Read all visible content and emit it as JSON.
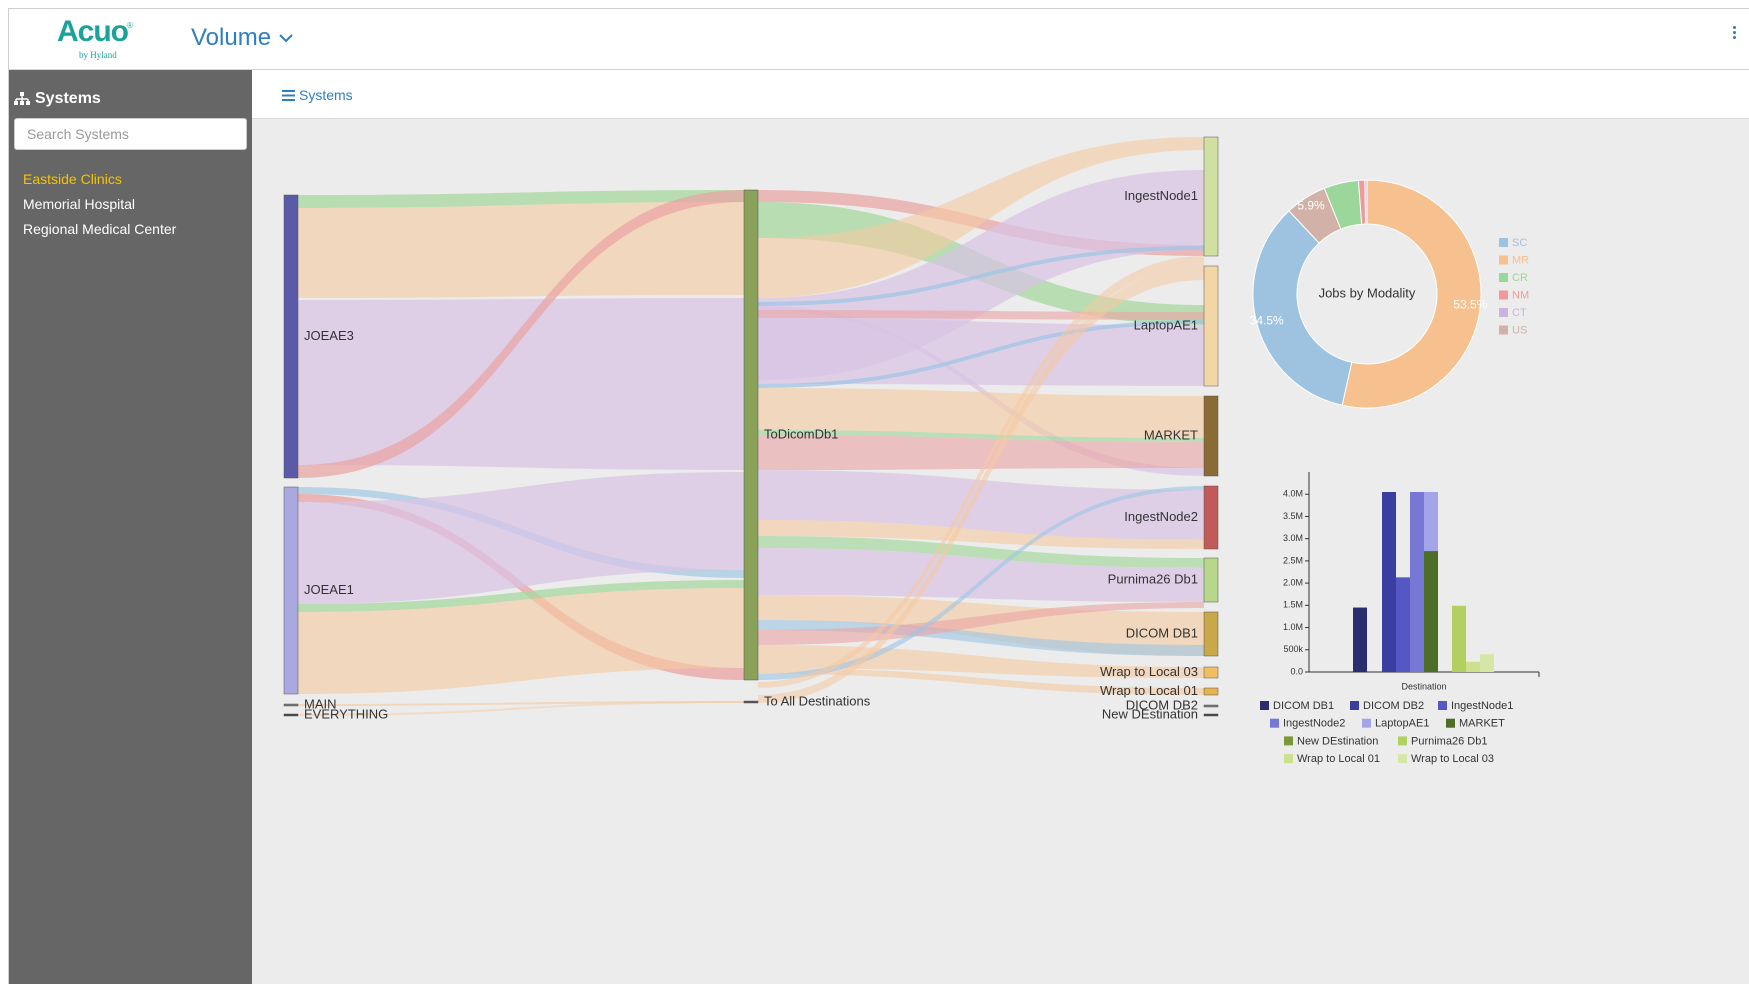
{
  "app": {
    "logo": "Acuo",
    "logo_reg": "®",
    "logo_sub": "by Hyland",
    "view": "Volume"
  },
  "sidebar": {
    "title": "Systems",
    "search_placeholder": "Search Systems",
    "items": [
      {
        "label": "Eastside Clinics",
        "active": true
      },
      {
        "label": "Memorial Hospital",
        "active": false
      },
      {
        "label": "Regional Medical Center",
        "active": false
      }
    ]
  },
  "breadcrumb": {
    "label": "Systems"
  },
  "sankey": {
    "sources": [
      {
        "label": "JOEAE3",
        "color": "#5a5aa8"
      },
      {
        "label": "JOEAE1",
        "color": "#a9a9e0"
      },
      {
        "label": "MAIN",
        "color": "#777777"
      },
      {
        "label": "EVERYTHING",
        "color": "#444444"
      }
    ],
    "middle": [
      {
        "label": "ToDicomDb1",
        "color": "#8aa15a"
      },
      {
        "label": "To All Destinations",
        "color": "#555555"
      }
    ],
    "destinations": [
      {
        "label": "IngestNode1",
        "color": "#cfe0a2"
      },
      {
        "label": "LaptopAE1",
        "color": "#f2d6a6"
      },
      {
        "label": "MARKET",
        "color": "#8a6a35"
      },
      {
        "label": "IngestNode2",
        "color": "#c25a5a"
      },
      {
        "label": "Purnima26 Db1",
        "color": "#b7d88a"
      },
      {
        "label": "DICOM DB1",
        "color": "#c9a84a"
      },
      {
        "label": "Wrap to Local 03",
        "color": "#f0c060"
      },
      {
        "label": "Wrap to Local 01",
        "color": "#e6b34d"
      },
      {
        "label": "DICOM DB2",
        "color": "#777777"
      },
      {
        "label": "New DEstination",
        "color": "#444444"
      }
    ],
    "colors": {
      "mr": "#f5c9a0",
      "ct": "#d9c3e6",
      "nm": "#eba3a3",
      "cr": "#a8d8a0",
      "sc": "#9cc4e4",
      "us": "#d4b0b0"
    }
  },
  "donut": {
    "title": "Jobs by Modality",
    "slices": [
      {
        "name": "SC",
        "value": 34.5,
        "label": "34.5%",
        "color": "#9ec3e0"
      },
      {
        "name": "MR",
        "value": 53.5,
        "label": "53.5%",
        "color": "#f7c08f"
      },
      {
        "name": "CR",
        "value": 4.9,
        "label": "",
        "color": "#9bd69a"
      },
      {
        "name": "NM",
        "value": 0.9,
        "label": "",
        "color": "#ef9a9a"
      },
      {
        "name": "CT",
        "value": 0.3,
        "label": "",
        "color": "#c9b3e0"
      },
      {
        "name": "US",
        "value": 5.9,
        "label": "5.9%",
        "color": "#d2b1a8"
      }
    ],
    "legend_order": [
      "SC",
      "MR",
      "CR",
      "NM",
      "CT",
      "US"
    ]
  },
  "chart_data": {
    "type": "bar",
    "xlabel": "Destination",
    "ylim": [
      0,
      4500000
    ],
    "ticks": [
      {
        "v": 0,
        "label": "0.0"
      },
      {
        "v": 500000,
        "label": "500k"
      },
      {
        "v": 1000000,
        "label": "1.0M"
      },
      {
        "v": 1500000,
        "label": "1.5M"
      },
      {
        "v": 2000000,
        "label": "2.0M"
      },
      {
        "v": 2500000,
        "label": "2.5M"
      },
      {
        "v": 3000000,
        "label": "3.0M"
      },
      {
        "v": 3500000,
        "label": "3.5M"
      },
      {
        "v": 4000000,
        "label": "4.0M"
      }
    ],
    "series": [
      {
        "name": "DICOM DB1",
        "value": 1450000,
        "color": "#2b2e6e"
      },
      {
        "name": "DICOM DB2",
        "value": 4050000,
        "color": "#3a3ea0"
      },
      {
        "name": "IngestNode1",
        "value": 2130000,
        "color": "#5558c2"
      },
      {
        "name": "IngestNode2",
        "value": 4050000,
        "color": "#7777d6"
      },
      {
        "name": "LaptopAE1",
        "value": 4050000,
        "color": "#a4a4e8"
      },
      {
        "name": "MARKET",
        "value": 2720000,
        "color": "#4e6e28"
      },
      {
        "name": "New DEstination",
        "value": 0,
        "color": "#7a9a3a"
      },
      {
        "name": "Purnima26 Db1",
        "value": 1490000,
        "color": "#b2d060"
      },
      {
        "name": "Wrap to Local 01",
        "value": 230000,
        "color": "#cce08e"
      },
      {
        "name": "Wrap to Local 03",
        "value": 400000,
        "color": "#d6e6a6"
      }
    ]
  }
}
